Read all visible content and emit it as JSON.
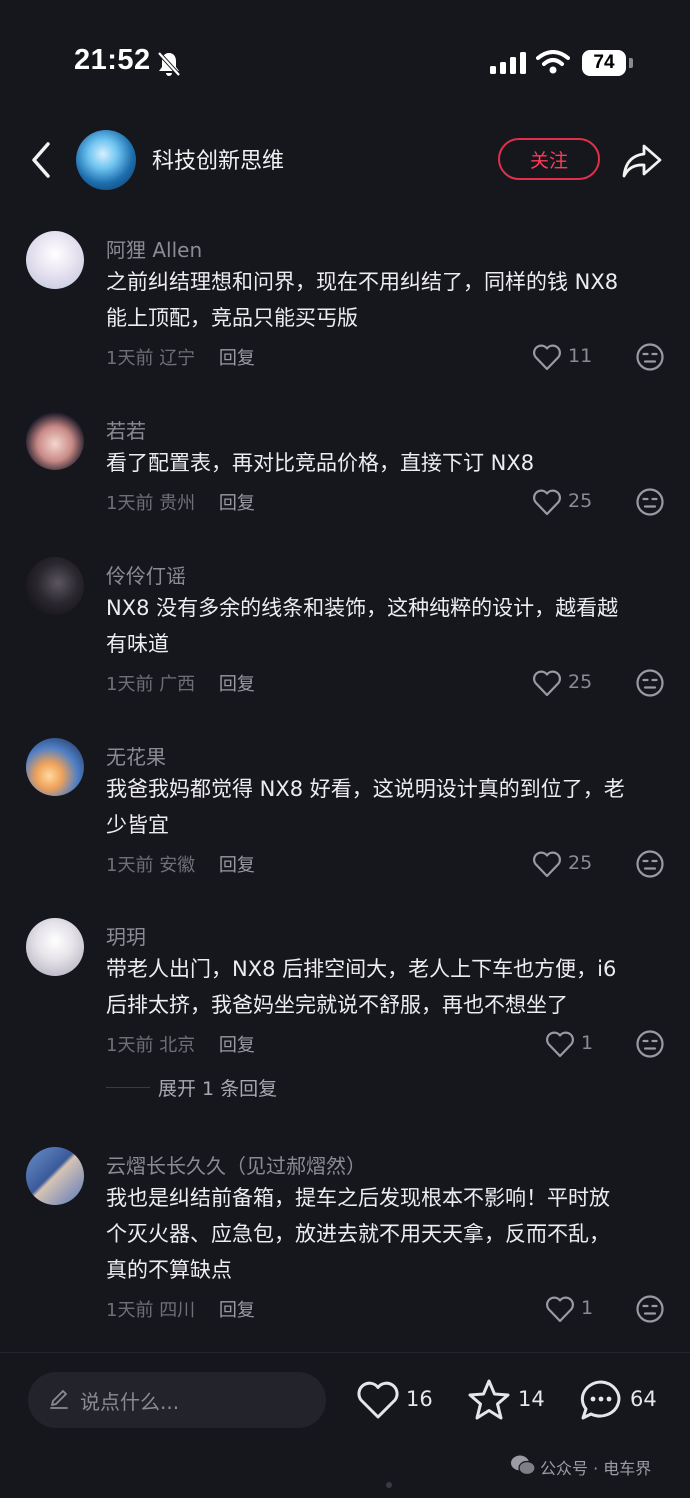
{
  "status_bar": {
    "time": "21:52",
    "battery": "74"
  },
  "header": {
    "title": "科技创新思维",
    "follow_label": "关注"
  },
  "comments": [
    {
      "user": "阿狸 Allen",
      "text": "之前纠结理想和问界，现在不用纠结了，同样的钱 NX8\n能上顶配，竞品只能买丐版",
      "time": "1天前",
      "location": "辽宁",
      "reply": "回复",
      "likes": "11"
    },
    {
      "user": "若若",
      "text": "看了配置表，再对比竞品价格，直接下订 NX8",
      "time": "1天前",
      "location": "贵州",
      "reply": "回复",
      "likes": "25"
    },
    {
      "user": "伶伶仃谣",
      "text": "NX8 没有多余的线条和装饰，这种纯粹的设计，越看越\n有味道",
      "time": "1天前",
      "location": "广西",
      "reply": "回复",
      "likes": "25"
    },
    {
      "user": "无花果",
      "text": "我爸我妈都觉得 NX8 好看，这说明设计真的到位了，老\n少皆宜",
      "time": "1天前",
      "location": "安徽",
      "reply": "回复",
      "likes": "25"
    },
    {
      "user": "玥玥",
      "text": "带老人出门，NX8 后排空间大，老人上下车也方便，i6\n后排太挤，我爸妈坐完就说不舒服，再也不想坐了",
      "time": "1天前",
      "location": "北京",
      "reply": "回复",
      "likes": "1",
      "expand": "展开 1 条回复"
    },
    {
      "user": "云熠长长久久（见过郝熠然）",
      "text": "我也是纠结前备箱，提车之后发现根本不影响！平时放\n个灭火器、应急包，放进去就不用天天拿，反而不乱，\n真的不算缺点",
      "time": "1天前",
      "location": "四川",
      "reply": "回复",
      "likes": "1"
    }
  ],
  "bottom_bar": {
    "placeholder": "说点什么...",
    "likes": "16",
    "favorites": "14",
    "comments": "64"
  },
  "watermark": "公众号 · 电车界",
  "colors": {
    "background": "#16161d",
    "accent": "#e0304a"
  }
}
